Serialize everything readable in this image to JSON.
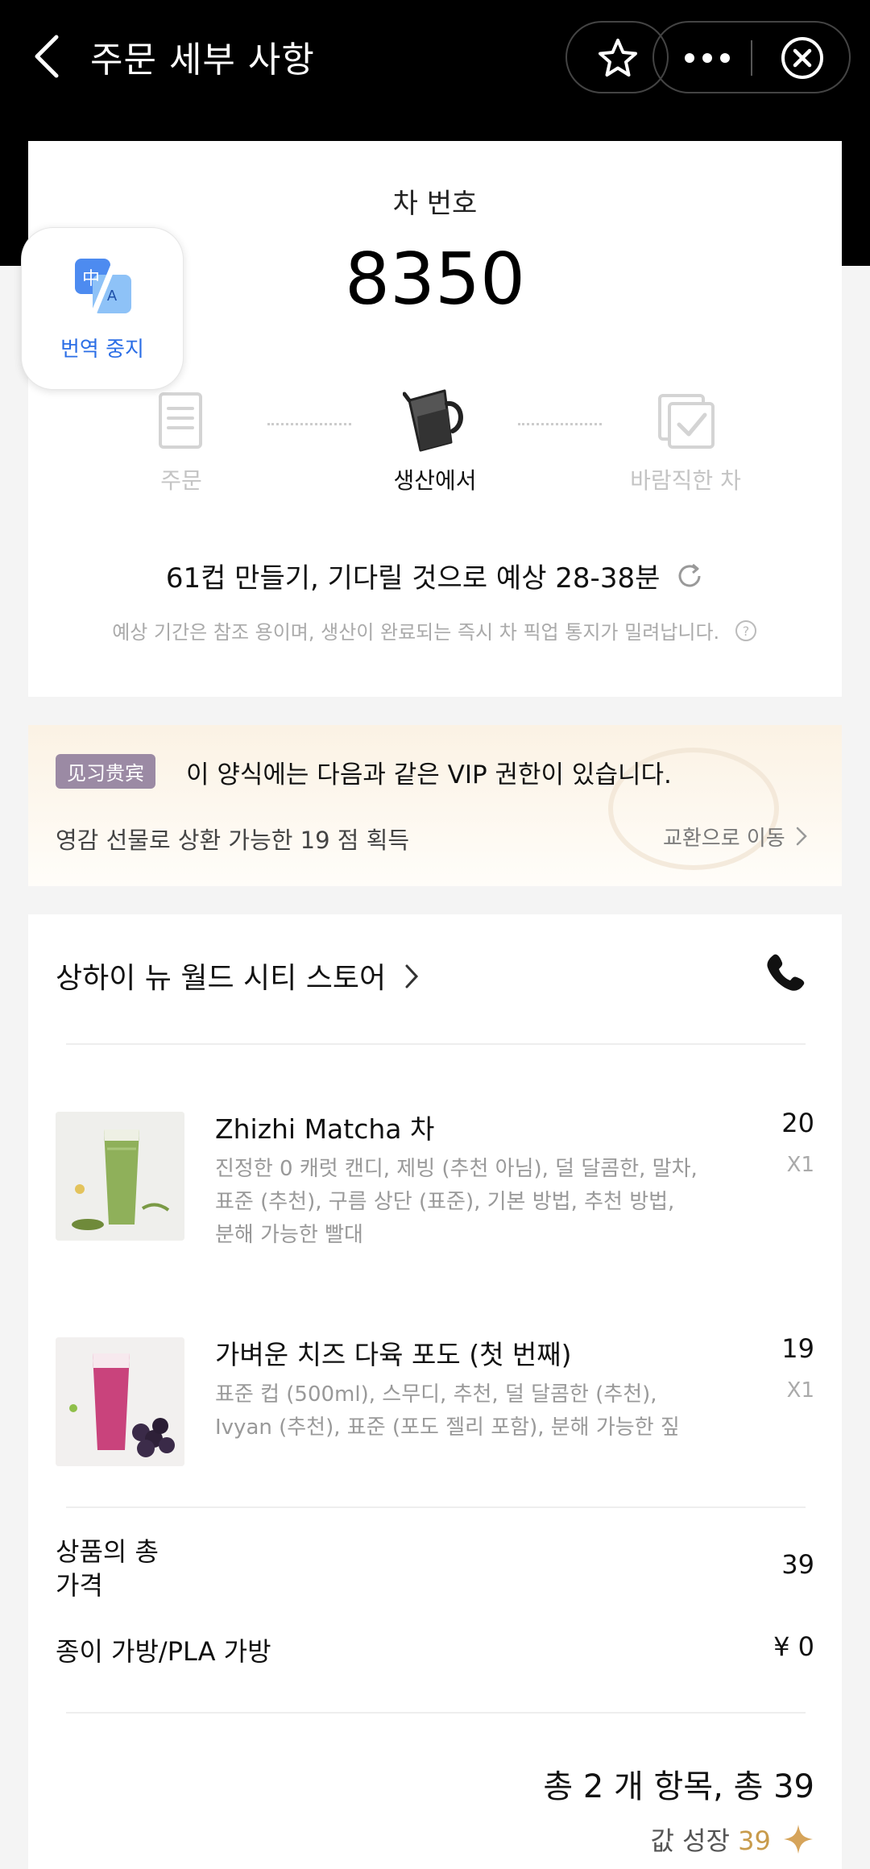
{
  "header": {
    "title": "주문 세부 사항",
    "back_icon": "chevron-left-icon",
    "favorite_icon": "star-icon",
    "more_icon": "more-dots-icon",
    "close_icon": "close-circle-icon"
  },
  "order": {
    "number_label": "차 번호",
    "number": "8350"
  },
  "translate_badge": {
    "label": "번역 중지",
    "icon": "translate-icon"
  },
  "progress": {
    "steps": [
      {
        "label": "주문",
        "icon": "receipt-icon",
        "state": "done"
      },
      {
        "label": "생산에서",
        "icon": "pitcher-icon",
        "state": "active"
      },
      {
        "label": "바람직한 차",
        "icon": "checkbox-icon",
        "state": "pending"
      }
    ]
  },
  "wait": {
    "text": "61컵 만들기, 기다릴 것으로 예상 28-38분",
    "refresh_icon": "refresh-icon",
    "note": "예상 기간은 참조 용이며, 생산이 완료되는 즉시 차 픽업 통지가 밀려납니다.",
    "help_icon": "question-circle-icon"
  },
  "vip": {
    "tag": "见习贵宾",
    "text": "이 양식에는 다음과 같은 VIP 권한이 있습니다.",
    "benefit": "영감 선물로 상환 가능한 19 점 획득",
    "link": "교환으로 이동"
  },
  "store": {
    "name": "상하이 뉴 월드 시티 스토어",
    "phone_icon": "phone-icon"
  },
  "items": [
    {
      "name": "Zhizhi Matcha 차",
      "desc": "진정한 0 캐럿 캔디, 제빙 (추천 아님), 덜 달콤한, 말차, 표준 (추천), 구름 상단 (표준), 기본 방법, 추천 방법, 분해 가능한 빨대",
      "price": "20",
      "qty": "X1"
    },
    {
      "name": "가벼운 치즈 다육 포도 (첫 번째)",
      "desc": "표준 컵 (500ml), 스무디, 추천, 덜 달콤한 (추천), Ivyan (추천), 표준 (포도 젤리 포함), 분해 가능한 짚",
      "price": "19",
      "qty": "X1"
    }
  ],
  "summary": {
    "goods_total_label": "상품의 총\n가격",
    "goods_total_value": "39",
    "bag_label": "종이 가방/PLA 가방",
    "bag_value": "¥ 0",
    "total_text": "총 2 개 항목, 총 39",
    "growth_label": "값 성장",
    "growth_value": "39"
  },
  "colors": {
    "header_bg": "#000000",
    "accent_gold": "#c89b4b",
    "translate_blue": "#2b6ee6",
    "vip_tag": "#9b8aa4"
  }
}
